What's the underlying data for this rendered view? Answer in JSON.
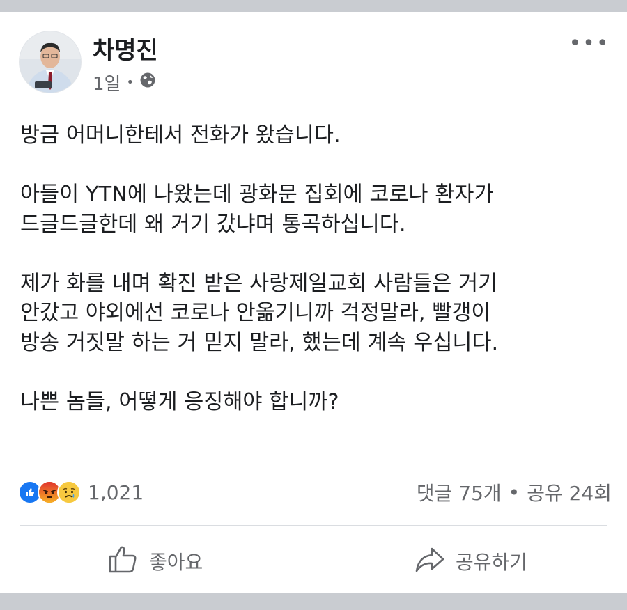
{
  "post": {
    "author": "차명진",
    "time": "1일",
    "separator": "•",
    "privacy_icon": "globe-icon",
    "more_icon": "•••",
    "paragraphs": [
      [
        "방금 어머니한테서 전화가 왔습니다."
      ],
      [
        "아들이 YTN에 나왔는데 광화문 집회에 코로나 환자가",
        "드글드글한데 왜 거기 갔냐며 통곡하십니다."
      ],
      [
        "제가 화를 내며 확진 받은 사랑제일교회 사람들은 거기",
        "안갔고 야외에선 코로나 안옮기니까 걱정말라, 빨갱이",
        "방송 거짓말 하는 거 믿지 말라, 했는데 계속 우십니다."
      ],
      [
        "나쁜 놈들, 어떻게 응징해야 합니까?"
      ]
    ]
  },
  "engagement": {
    "reaction_icons": [
      "like-reaction-icon",
      "angry-reaction-icon",
      "sad-reaction-icon"
    ],
    "reaction_count": "1,021",
    "comments": "댓글 75개",
    "dot": "•",
    "shares": "공유 24회"
  },
  "actions": {
    "like_label": "좋아요",
    "share_label": "공유하기"
  },
  "colors": {
    "background": "#c9ccd1",
    "card": "#ffffff",
    "text": "#1c1e21",
    "secondary": "#65676b",
    "like_blue": "#1877f2",
    "angry_orange": "#e9710f"
  }
}
